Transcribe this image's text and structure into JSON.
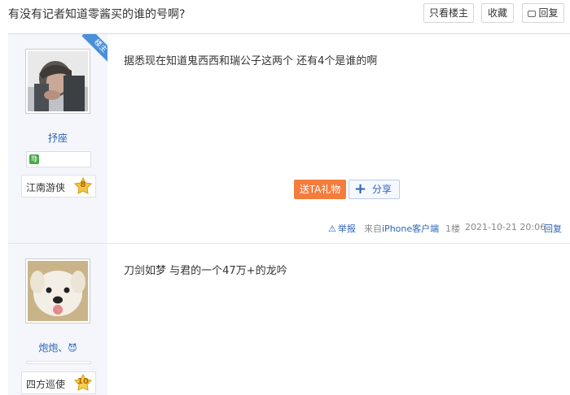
{
  "thread": {
    "title": "有没有记者知道零酱买的谁的号啊?",
    "buttons": {
      "only_op": "只看楼主",
      "favorite": "收藏",
      "reply": "回复"
    }
  },
  "posts": [
    {
      "username": "抒座",
      "zodiac_symbol": "♍",
      "op_badge": "楼主",
      "rank": "江南游侠",
      "level": "8",
      "content": "据悉现在知道鬼西西和瑞公子这两个 还有4个是谁的啊",
      "gift_label": "送TA礼物",
      "share_label": "分享",
      "report_label": "举报",
      "from_prefix": "来自",
      "from_device": "iPhone客户端",
      "floor": "1楼",
      "date": "2021-10-21 20:06",
      "reply_label": "回复"
    },
    {
      "username": "炮炮、",
      "username_icon": "😈",
      "rank": "四方巡使",
      "level": "10",
      "content": "刀剑如梦 与君的一个47万+的龙吟"
    }
  ],
  "colors": {
    "link": "#2d64b3",
    "gift": "#f47c3c",
    "sidebar": "#f4f6fb",
    "badge": "#4a90d9"
  }
}
